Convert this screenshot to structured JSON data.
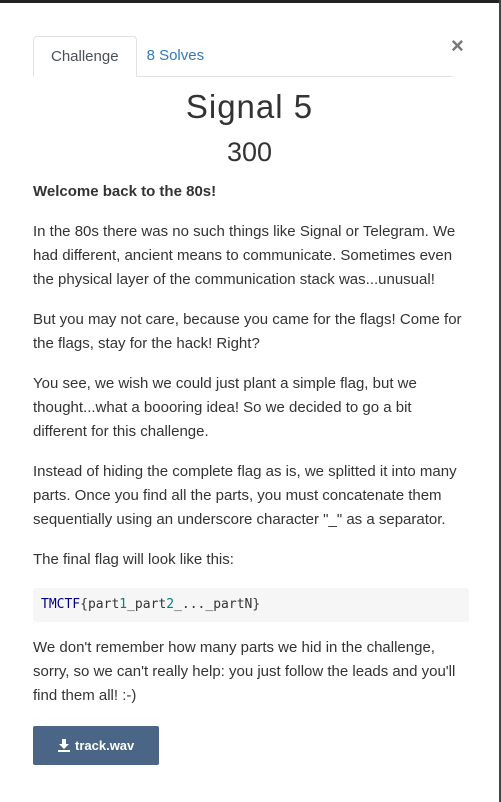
{
  "tabs": [
    {
      "label": "Challenge",
      "active": true
    },
    {
      "label": "8 Solves",
      "active": false
    }
  ],
  "close_symbol": "×",
  "challenge": {
    "name": "Signal 5",
    "value": "300"
  },
  "description": {
    "welcome": "Welcome back to the 80s!",
    "p1": "In the 80s there was no such things like Signal or Telegram. We had different, ancient means to communicate. Sometimes even the physical layer of the communication stack was...unusual!",
    "p2": "But you may not care, because you came for the flags! Come for the flags, stay for the hack! Right?",
    "p3": "You see, we wish we could just plant a simple flag, but we thought...what a boooring idea! So we decided to go a bit different for this challenge.",
    "p4": "Instead of hiding the complete flag as is, we splitted it into many parts. Once you find all the parts, you must concatenate them sequentially using an underscore character \"_\" as a separator.",
    "p5": "The final flag will look like this:",
    "code": {
      "prefix": "TMCTF",
      "open": "{part",
      "n1": "1",
      "mid": "_part",
      "n2": "2",
      "rest": "_..._partN}"
    },
    "p6": "We don't remember how many parts we hid in the challenge, sorry, so we can't really help: you just follow the leads and you'll find them all! :-)"
  },
  "file": {
    "label": "track.wav",
    "icon": "download-icon",
    "button_color": "#4a6586"
  }
}
